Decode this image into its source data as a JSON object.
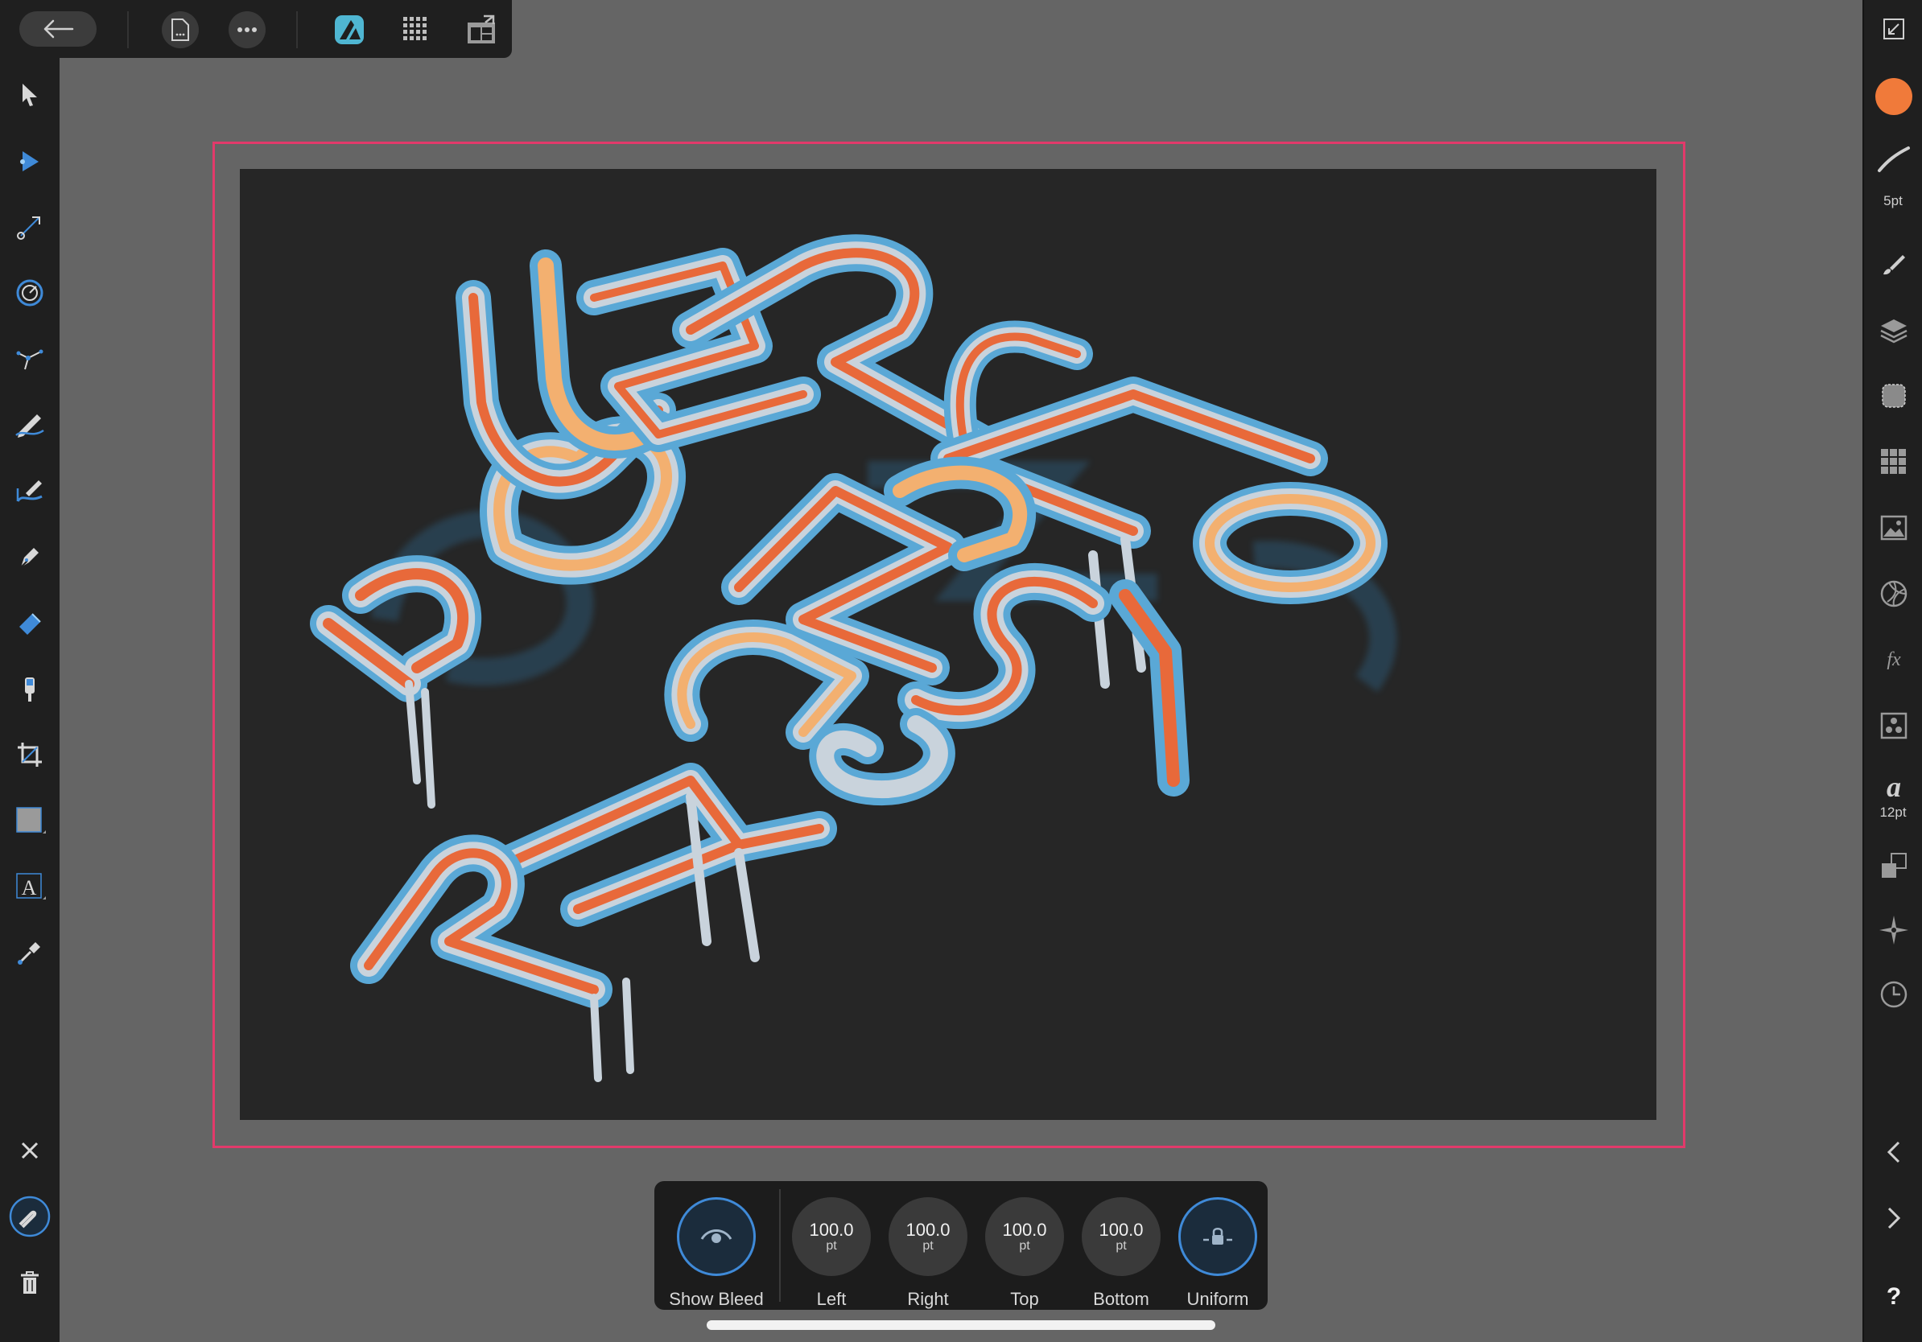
{
  "toolbar": {
    "back_icon": "back-arrow-icon",
    "document_icon": "document-icon",
    "more_icon": "more-icon",
    "persona_icon": "designer-persona-icon",
    "grid_icon": "pixel-grid-icon",
    "export_icon": "export-persona-icon"
  },
  "right_panel": {
    "stroke_size": "5pt",
    "text_size": "12pt",
    "fill_color": "#f07a3a",
    "help_label": "?"
  },
  "context_toolbar": {
    "show_bleed_label": "Show Bleed",
    "left": {
      "value": "100.0",
      "unit": "pt",
      "label": "Left"
    },
    "right": {
      "value": "100.0",
      "unit": "pt",
      "label": "Right"
    },
    "top": {
      "value": "100.0",
      "unit": "pt",
      "label": "Top"
    },
    "bottom": {
      "value": "100.0",
      "unit": "pt",
      "label": "Bottom"
    },
    "uniform_label": "Uniform"
  },
  "colors": {
    "bleed_guide": "#e23a6b",
    "accent_blue": "#3f8ad8",
    "art_blue": "#5aa8d6",
    "art_orange": "#e8693a",
    "art_peach": "#f3b070",
    "art_silver": "#c9d3dc"
  }
}
